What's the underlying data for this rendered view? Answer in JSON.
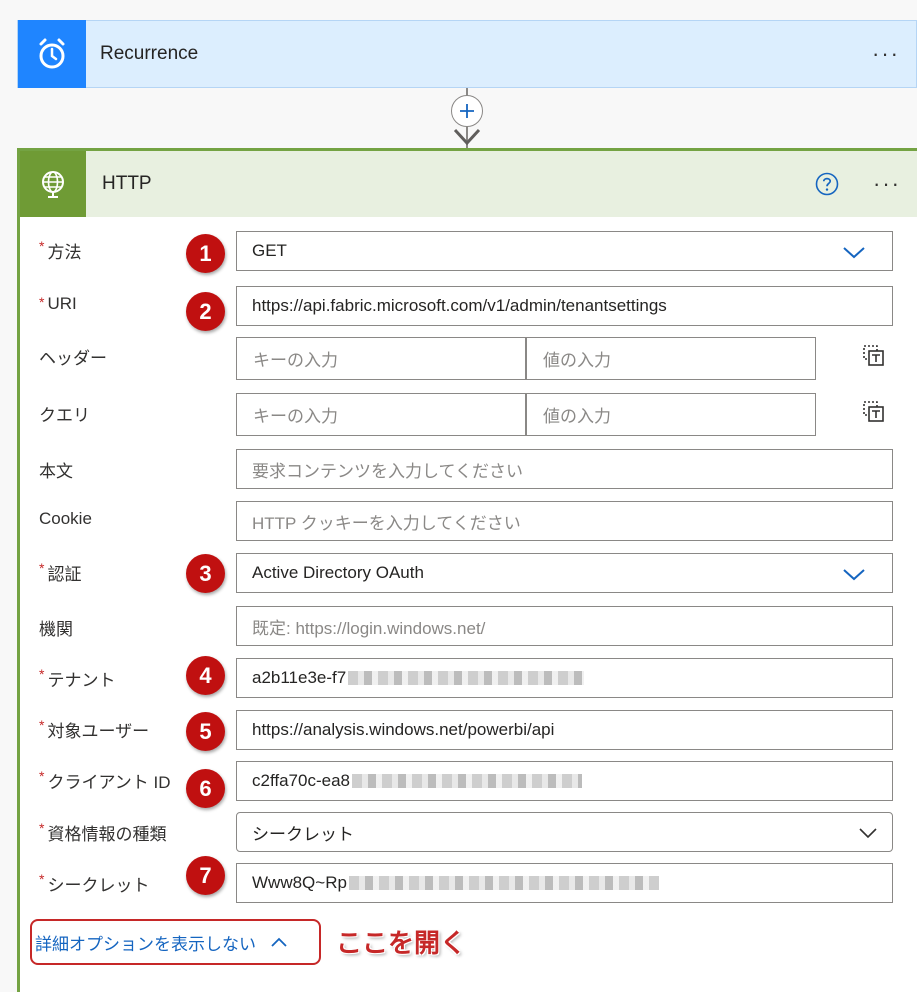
{
  "recurrence": {
    "title": "Recurrence",
    "more": "···"
  },
  "http": {
    "title": "HTTP",
    "more": "···"
  },
  "fields": {
    "method": {
      "label": "方法",
      "value": "GET",
      "badge": "1"
    },
    "uri": {
      "label": "URI",
      "value": "https://api.fabric.microsoft.com/v1/admin/tenantsettings",
      "badge": "2"
    },
    "headers": {
      "label": "ヘッダー",
      "key_placeholder": "キーの入力",
      "value_placeholder": "値の入力"
    },
    "queries": {
      "label": "クエリ",
      "key_placeholder": "キーの入力",
      "value_placeholder": "値の入力"
    },
    "body": {
      "label": "本文",
      "placeholder": "要求コンテンツを入力してください"
    },
    "cookie": {
      "label": "Cookie",
      "placeholder": "HTTP クッキーを入力してください"
    },
    "auth": {
      "label": "認証",
      "value": "Active Directory OAuth",
      "badge": "3"
    },
    "authority": {
      "label": "機関",
      "placeholder": "既定: https://login.windows.net/"
    },
    "tenant": {
      "label": "テナント",
      "value": "a2b11e3e-f7",
      "badge": "4"
    },
    "audience": {
      "label": "対象ユーザー",
      "value": "https://analysis.windows.net/powerbi/api",
      "badge": "5"
    },
    "client_id": {
      "label": "クライアント ID",
      "value": "c2ffa70c-ea8",
      "badge": "6"
    },
    "credential_type": {
      "label": "資格情報の種類",
      "value": "シークレット"
    },
    "secret": {
      "label": "シークレット",
      "value": "Www8Q~Rp",
      "badge": "7"
    }
  },
  "advanced": {
    "label": "詳細オプションを表示しない"
  },
  "callout": "ここを開く",
  "colors": {
    "recurrence_accent": "#1f85ff",
    "http_accent": "#6f9b35",
    "badge": "#c01010",
    "link": "#1565c0"
  }
}
